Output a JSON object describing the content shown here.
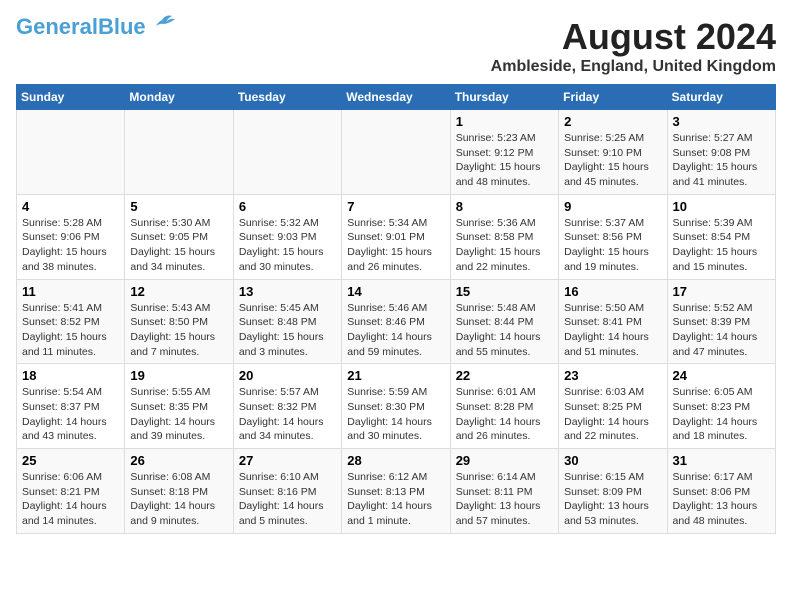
{
  "header": {
    "logo_line1": "General",
    "logo_line2": "Blue",
    "month_year": "August 2024",
    "location": "Ambleside, England, United Kingdom"
  },
  "weekdays": [
    "Sunday",
    "Monday",
    "Tuesday",
    "Wednesday",
    "Thursday",
    "Friday",
    "Saturday"
  ],
  "weeks": [
    [
      {
        "day": "",
        "info": ""
      },
      {
        "day": "",
        "info": ""
      },
      {
        "day": "",
        "info": ""
      },
      {
        "day": "",
        "info": ""
      },
      {
        "day": "1",
        "info": "Sunrise: 5:23 AM\nSunset: 9:12 PM\nDaylight: 15 hours\nand 48 minutes."
      },
      {
        "day": "2",
        "info": "Sunrise: 5:25 AM\nSunset: 9:10 PM\nDaylight: 15 hours\nand 45 minutes."
      },
      {
        "day": "3",
        "info": "Sunrise: 5:27 AM\nSunset: 9:08 PM\nDaylight: 15 hours\nand 41 minutes."
      }
    ],
    [
      {
        "day": "4",
        "info": "Sunrise: 5:28 AM\nSunset: 9:06 PM\nDaylight: 15 hours\nand 38 minutes."
      },
      {
        "day": "5",
        "info": "Sunrise: 5:30 AM\nSunset: 9:05 PM\nDaylight: 15 hours\nand 34 minutes."
      },
      {
        "day": "6",
        "info": "Sunrise: 5:32 AM\nSunset: 9:03 PM\nDaylight: 15 hours\nand 30 minutes."
      },
      {
        "day": "7",
        "info": "Sunrise: 5:34 AM\nSunset: 9:01 PM\nDaylight: 15 hours\nand 26 minutes."
      },
      {
        "day": "8",
        "info": "Sunrise: 5:36 AM\nSunset: 8:58 PM\nDaylight: 15 hours\nand 22 minutes."
      },
      {
        "day": "9",
        "info": "Sunrise: 5:37 AM\nSunset: 8:56 PM\nDaylight: 15 hours\nand 19 minutes."
      },
      {
        "day": "10",
        "info": "Sunrise: 5:39 AM\nSunset: 8:54 PM\nDaylight: 15 hours\nand 15 minutes."
      }
    ],
    [
      {
        "day": "11",
        "info": "Sunrise: 5:41 AM\nSunset: 8:52 PM\nDaylight: 15 hours\nand 11 minutes."
      },
      {
        "day": "12",
        "info": "Sunrise: 5:43 AM\nSunset: 8:50 PM\nDaylight: 15 hours\nand 7 minutes."
      },
      {
        "day": "13",
        "info": "Sunrise: 5:45 AM\nSunset: 8:48 PM\nDaylight: 15 hours\nand 3 minutes."
      },
      {
        "day": "14",
        "info": "Sunrise: 5:46 AM\nSunset: 8:46 PM\nDaylight: 14 hours\nand 59 minutes."
      },
      {
        "day": "15",
        "info": "Sunrise: 5:48 AM\nSunset: 8:44 PM\nDaylight: 14 hours\nand 55 minutes."
      },
      {
        "day": "16",
        "info": "Sunrise: 5:50 AM\nSunset: 8:41 PM\nDaylight: 14 hours\nand 51 minutes."
      },
      {
        "day": "17",
        "info": "Sunrise: 5:52 AM\nSunset: 8:39 PM\nDaylight: 14 hours\nand 47 minutes."
      }
    ],
    [
      {
        "day": "18",
        "info": "Sunrise: 5:54 AM\nSunset: 8:37 PM\nDaylight: 14 hours\nand 43 minutes."
      },
      {
        "day": "19",
        "info": "Sunrise: 5:55 AM\nSunset: 8:35 PM\nDaylight: 14 hours\nand 39 minutes."
      },
      {
        "day": "20",
        "info": "Sunrise: 5:57 AM\nSunset: 8:32 PM\nDaylight: 14 hours\nand 34 minutes."
      },
      {
        "day": "21",
        "info": "Sunrise: 5:59 AM\nSunset: 8:30 PM\nDaylight: 14 hours\nand 30 minutes."
      },
      {
        "day": "22",
        "info": "Sunrise: 6:01 AM\nSunset: 8:28 PM\nDaylight: 14 hours\nand 26 minutes."
      },
      {
        "day": "23",
        "info": "Sunrise: 6:03 AM\nSunset: 8:25 PM\nDaylight: 14 hours\nand 22 minutes."
      },
      {
        "day": "24",
        "info": "Sunrise: 6:05 AM\nSunset: 8:23 PM\nDaylight: 14 hours\nand 18 minutes."
      }
    ],
    [
      {
        "day": "25",
        "info": "Sunrise: 6:06 AM\nSunset: 8:21 PM\nDaylight: 14 hours\nand 14 minutes."
      },
      {
        "day": "26",
        "info": "Sunrise: 6:08 AM\nSunset: 8:18 PM\nDaylight: 14 hours\nand 9 minutes."
      },
      {
        "day": "27",
        "info": "Sunrise: 6:10 AM\nSunset: 8:16 PM\nDaylight: 14 hours\nand 5 minutes."
      },
      {
        "day": "28",
        "info": "Sunrise: 6:12 AM\nSunset: 8:13 PM\nDaylight: 14 hours\nand 1 minute."
      },
      {
        "day": "29",
        "info": "Sunrise: 6:14 AM\nSunset: 8:11 PM\nDaylight: 13 hours\nand 57 minutes."
      },
      {
        "day": "30",
        "info": "Sunrise: 6:15 AM\nSunset: 8:09 PM\nDaylight: 13 hours\nand 53 minutes."
      },
      {
        "day": "31",
        "info": "Sunrise: 6:17 AM\nSunset: 8:06 PM\nDaylight: 13 hours\nand 48 minutes."
      }
    ]
  ]
}
